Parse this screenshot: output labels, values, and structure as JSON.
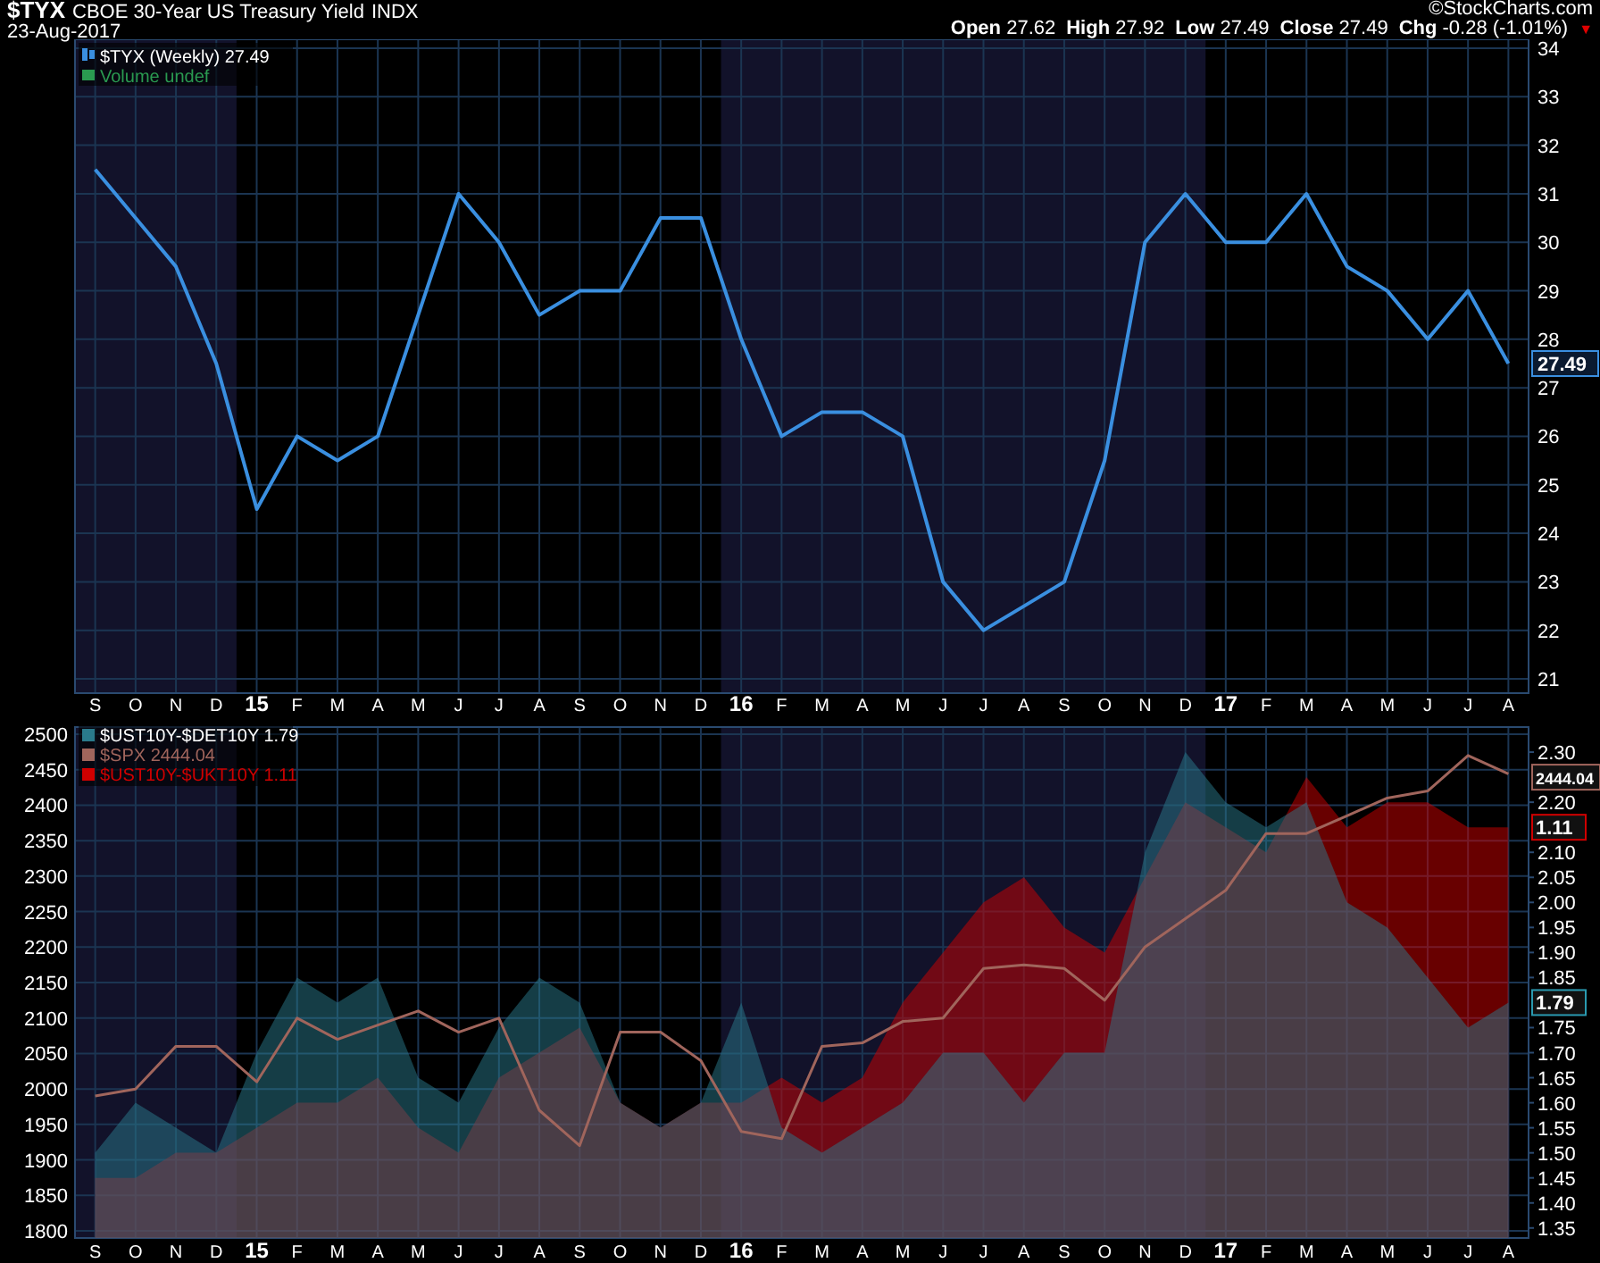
{
  "header": {
    "symbol": "$TYX",
    "name": "CBOE 30-Year US Treasury Yield",
    "exchange": "INDX",
    "date": "23-Aug-2017",
    "credit": "©StockCharts.com",
    "quote": [
      {
        "label": "Open",
        "value": "27.62"
      },
      {
        "label": "High",
        "value": "27.92"
      },
      {
        "label": "Low",
        "value": "27.49"
      },
      {
        "label": "Close",
        "value": "27.49"
      },
      {
        "label": "Chg",
        "value": "-0.28 (-1.01%)"
      }
    ],
    "change_marker": "▼"
  },
  "price_panel": {
    "legend": [
      "(Weekly) 27.49",
      "Volume undef"
    ],
    "last_label": "27.49",
    "chart_data": {
      "type": "line",
      "categories": [
        "S",
        "O",
        "N",
        "D",
        "15",
        "F",
        "M",
        "A",
        "M",
        "J",
        "J",
        "A",
        "S",
        "O",
        "N",
        "D",
        "16",
        "F",
        "M",
        "A",
        "M",
        "J",
        "J",
        "A",
        "S",
        "O",
        "N",
        "D",
        "17",
        "F",
        "M",
        "A",
        "M",
        "J",
        "J",
        "A"
      ],
      "grid": true,
      "series": [
        {
          "name": "$TYX",
          "color": "#3a8fe0",
          "values": [
            31.5,
            30.5,
            29.5,
            27.5,
            24.5,
            26,
            25.5,
            26,
            28.5,
            31,
            30,
            28.5,
            29,
            29,
            30.5,
            30.5,
            28,
            26,
            26.5,
            26.5,
            26,
            23,
            22,
            22.5,
            23,
            25.5,
            30,
            31,
            30,
            30,
            31,
            29.5,
            29,
            28,
            29,
            27.5
          ]
        }
      ],
      "ylim": [
        21,
        34
      ],
      "yticks": [
        21,
        22,
        23,
        24,
        25,
        26,
        27,
        28,
        29,
        30,
        31,
        32,
        33,
        34
      ]
    }
  },
  "spread_panel": {
    "legend": [
      {
        "text": "1.79",
        "color": "#2a7a8c"
      },
      {
        "text": "2444.04",
        "color": "#a0655c"
      },
      {
        "text": "1.11",
        "color": "#d00000"
      }
    ],
    "last_labels": [
      {
        "text": "2444.04",
        "color": "#a0655c"
      },
      {
        "text": "1.11",
        "color": "#d00000"
      },
      {
        "text": "1.79",
        "color": "#2a9ab0"
      }
    ],
    "chart_data": {
      "type": "area",
      "categories": [
        "S",
        "O",
        "N",
        "D",
        "15",
        "F",
        "M",
        "A",
        "M",
        "J",
        "J",
        "A",
        "S",
        "O",
        "N",
        "D",
        "16",
        "F",
        "M",
        "A",
        "M",
        "J",
        "J",
        "A",
        "S",
        "O",
        "N",
        "D",
        "17",
        "F",
        "M",
        "A",
        "M",
        "J",
        "J",
        "A"
      ],
      "grid": true,
      "series": [
        {
          "name": "$UST10Y-$DET10Y",
          "color": "#2a7a8c",
          "axis": "y2",
          "values": [
            1.5,
            1.6,
            1.55,
            1.5,
            1.7,
            1.85,
            1.8,
            1.85,
            1.65,
            1.6,
            1.75,
            1.85,
            1.8,
            1.6,
            1.55,
            1.6,
            1.8,
            1.55,
            1.5,
            1.55,
            1.6,
            1.7,
            1.7,
            1.6,
            1.7,
            1.7,
            2.1,
            2.3,
            2.2,
            2.15,
            2.2,
            2,
            1.95,
            1.85,
            1.75,
            1.8
          ]
        },
        {
          "name": "$SPX",
          "color": "#a0655c",
          "type": "line",
          "values": [
            1990,
            2000,
            2060,
            2060,
            2010,
            2100,
            2070,
            2090,
            2110,
            2080,
            2100,
            1970,
            1920,
            2080,
            2080,
            2040,
            1940,
            1930,
            2060,
            2065,
            2095,
            2100,
            2170,
            2175,
            2170,
            2125,
            2200,
            2240,
            2280,
            2360,
            2360,
            2385,
            2410,
            2420,
            2470,
            2444
          ]
        },
        {
          "name": "$UST10Y-$UKT10Y",
          "color": "#d00000",
          "axis": "y2",
          "values": [
            1.45,
            1.45,
            1.5,
            1.5,
            1.55,
            1.6,
            1.6,
            1.65,
            1.55,
            1.5,
            1.65,
            1.7,
            1.75,
            1.6,
            1.55,
            1.6,
            1.6,
            1.65,
            1.6,
            1.65,
            1.8,
            1.9,
            2,
            2.05,
            1.95,
            1.9,
            2.05,
            2.2,
            2.15,
            2.1,
            2.25,
            2.15,
            2.2,
            2.2,
            2.15,
            2.15
          ]
        }
      ],
      "ylim": [
        1800,
        2500
      ],
      "yticks": [
        1800,
        1850,
        1900,
        1950,
        2000,
        2050,
        2100,
        2150,
        2200,
        2250,
        2300,
        2350,
        2400,
        2450,
        2500
      ],
      "y2lim": [
        1.33,
        2.35
      ],
      "y2ticks": [
        1.35,
        {
          "value": 1.4,
          "label": "1.40"
        },
        1.45,
        {
          "value": 1.5,
          "label": "1.50"
        },
        1.55,
        {
          "value": 1.6,
          "label": "1.60"
        },
        1.65,
        {
          "value": 1.7,
          "label": "1.70"
        },
        1.75,
        1.85,
        {
          "value": 1.9,
          "label": "1.90"
        },
        1.95,
        {
          "value": 2,
          "label": "2.00"
        },
        2.05,
        {
          "value": 2.1,
          "label": "2.10"
        },
        {
          "value": 2.2,
          "label": "2.20"
        },
        {
          "value": 2.3,
          "label": "2.30"
        }
      ]
    }
  }
}
